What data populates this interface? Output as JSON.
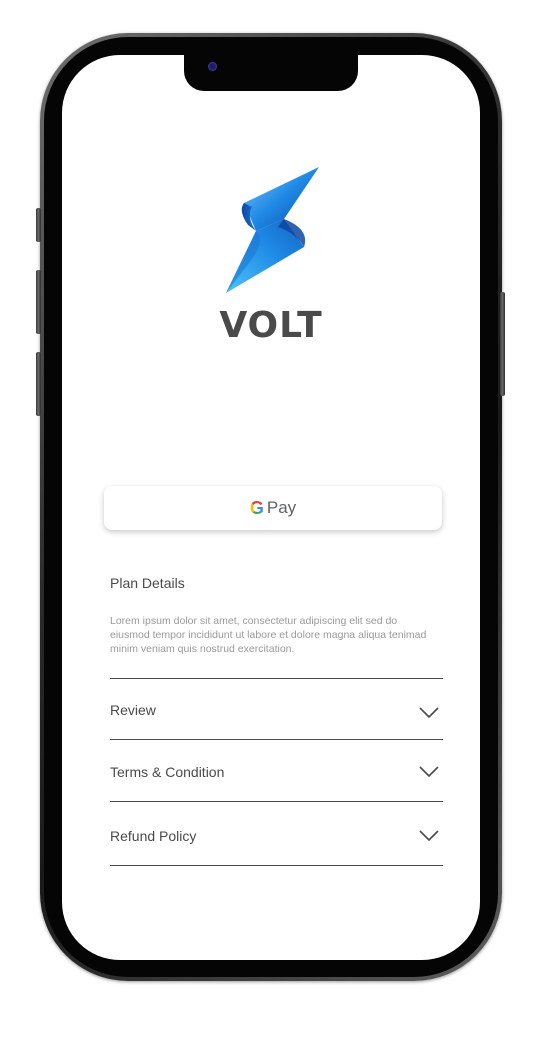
{
  "app": {
    "brand_name": "VOLT"
  },
  "payment": {
    "gpay_g": "G",
    "gpay_label": "Pay"
  },
  "plan": {
    "title": "Plan Details",
    "description": "Lorem ipsum dolor sit amet, consectetur adipiscing elit sed do eiusmod tempor incididunt ut labore et dolore magna aliqua tenimad minim veniam quis nostrud exercitation."
  },
  "accordion": {
    "items": [
      {
        "label": "Review",
        "icon": "chevron-down-icon"
      },
      {
        "label": "Terms & Condition",
        "icon": "chevron-down-icon"
      },
      {
        "label": "Refund Policy",
        "icon": "chevron-down-icon"
      }
    ]
  },
  "colors": {
    "brand_blue": "#1e88e5",
    "brand_text": "#4a4a4a",
    "muted_text": "#9a9a9a"
  }
}
